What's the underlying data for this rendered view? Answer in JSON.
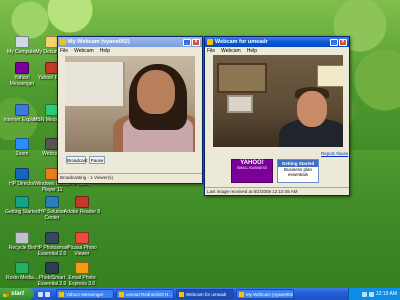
{
  "desktop": {
    "icons": [
      {
        "label": "My Computer",
        "icon": "computer-icon",
        "color": "#cfd8e6"
      },
      {
        "label": "My Documents",
        "icon": "folder-icon",
        "color": "#f3d36b"
      },
      {
        "label": "Yahoo! Messenger",
        "icon": "messenger-icon",
        "color": "#7b0099"
      },
      {
        "label": "Yahoo! Pla...",
        "icon": "app-icon",
        "color": "#c0392b"
      },
      {
        "label": "Internet Explorer",
        "icon": "ie-icon",
        "color": "#3b7be0"
      },
      {
        "label": "MSN Messenger",
        "icon": "msn-icon",
        "color": "#2ecc71"
      },
      {
        "label": "Zoom",
        "icon": "zoom-icon",
        "color": "#2d8cff"
      },
      {
        "label": "Webcam",
        "icon": "webcam-icon",
        "color": "#555555"
      },
      {
        "label": "HP Director",
        "icon": "hp-icon",
        "color": "#1565c0"
      },
      {
        "label": "Windows Media Player 11",
        "icon": "media-player-icon",
        "color": "#e67e22"
      },
      {
        "label": "Photo...",
        "icon": "photo-icon",
        "color": "#8e44ad"
      },
      {
        "label": "Getting Started",
        "icon": "start-guide-icon",
        "color": "#16a085"
      },
      {
        "label": "HP Solution Center",
        "icon": "hp-solution-icon",
        "color": "#2980b9"
      },
      {
        "label": "Adobe Reader 8",
        "icon": "pdf-icon",
        "color": "#c0392b"
      },
      {
        "label": "Recycle Bin",
        "icon": "recycle-bin-icon",
        "color": "#bdc3c7"
      },
      {
        "label": "HP Photosmart Essential 2.0",
        "icon": "hp-photo-icon",
        "color": "#34495e"
      },
      {
        "label": "Picasa Photo Viewer",
        "icon": "picasa-icon",
        "color": "#e74c3c"
      },
      {
        "label": "Roxio Media...",
        "icon": "roxio-icon",
        "color": "#27ae60"
      },
      {
        "label": "PhotoSmart Essential 2.0",
        "icon": "photosmart-icon",
        "color": "#2c3e50"
      },
      {
        "label": "Email Photo Express 3.0",
        "icon": "email-photo-icon",
        "color": "#f39c12"
      }
    ]
  },
  "windows": {
    "my_webcam": {
      "title": "My Webcam (vyane002)",
      "menu": [
        "File",
        "Webcam",
        "Help"
      ],
      "broadcast_button": "Broadcast",
      "pause_button": "Pause",
      "status": "Broadcasting - 1 Viewer(s)"
    },
    "friend_webcam": {
      "title": "Webcam for umeadr",
      "menu": [
        "File",
        "Webcam",
        "Help"
      ],
      "report_link": "Report Abuse",
      "ad_yahoo_title": "YAHOO!",
      "ad_yahoo_sub": "SMALL BUSINESS",
      "ad_box_header": "Getting Started",
      "ad_box_line1": "Business plan",
      "ad_box_line2": "essentials",
      "status": "Last image received at 8/2/2008 12:10:45 AM"
    }
  },
  "taskbar": {
    "start_label": "start",
    "buttons": [
      {
        "label": "Yahoo! Messenger",
        "active": false
      },
      {
        "label": "umead Redneck03 H...",
        "active": false
      },
      {
        "label": "Webcam for umeadr",
        "active": true
      },
      {
        "label": "My Webcam (vyane002)",
        "active": false
      }
    ],
    "clock": "12:19 AM"
  }
}
